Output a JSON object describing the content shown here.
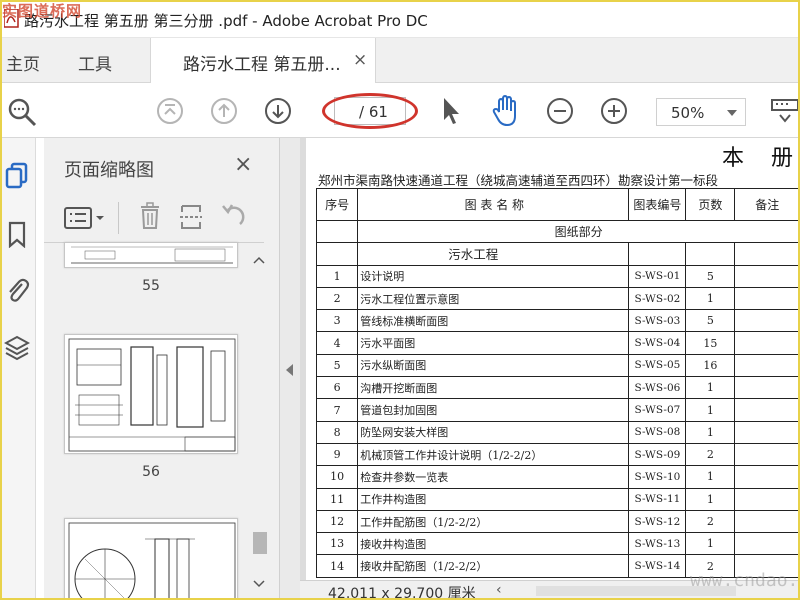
{
  "window": {
    "title": "路污水工程  第五册 第三分册 .pdf - Adobe Acrobat Pro DC",
    "watermark_top": "实图道桥网",
    "watermark_bottom": "www.cndao.com"
  },
  "menu": {
    "home": "主页",
    "tools": "工具",
    "doc_tab_label": "路污水工程 第五册...",
    "doc_tab_close": "×"
  },
  "toolbar": {
    "page_total": "/ 61",
    "zoom": "50%"
  },
  "thumbnails": {
    "title": "页面缩略图",
    "close": "×",
    "pages": [
      {
        "label": "55"
      },
      {
        "label": "56"
      },
      {
        "label": ""
      }
    ]
  },
  "document": {
    "big_title": "本 册 图",
    "subtitle": "郑州市渠南路快速通道工程（绕城高速辅道至西四环）勘察设计第一标段",
    "table": {
      "headers": [
        "序号",
        "图 表 名 称",
        "图表编号",
        "页数",
        "备注"
      ],
      "section": "图纸部分",
      "subsection": "污水工程",
      "rows": [
        {
          "no": "1",
          "name": "设计说明",
          "code": "S-WS-01",
          "pages": "5"
        },
        {
          "no": "2",
          "name": "污水工程位置示意图",
          "code": "S-WS-02",
          "pages": "1"
        },
        {
          "no": "3",
          "name": "管线标准横断面图",
          "code": "S-WS-03",
          "pages": "5"
        },
        {
          "no": "4",
          "name": "污水平面图",
          "code": "S-WS-04",
          "pages": "15"
        },
        {
          "no": "5",
          "name": "污水纵断面图",
          "code": "S-WS-05",
          "pages": "16"
        },
        {
          "no": "6",
          "name": "沟槽开挖断面图",
          "code": "S-WS-06",
          "pages": "1"
        },
        {
          "no": "7",
          "name": "管道包封加固图",
          "code": "S-WS-07",
          "pages": "1"
        },
        {
          "no": "8",
          "name": "防坠网安装大样图",
          "code": "S-WS-08",
          "pages": "1"
        },
        {
          "no": "9",
          "name": "机械顶管工作井设计说明（1/2-2/2）",
          "code": "S-WS-09",
          "pages": "2"
        },
        {
          "no": "10",
          "name": "检查井参数一览表",
          "code": "S-WS-10",
          "pages": "1"
        },
        {
          "no": "11",
          "name": "工作井构造图",
          "code": "S-WS-11",
          "pages": "1"
        },
        {
          "no": "12",
          "name": "工作井配筋图（1/2-2/2）",
          "code": "S-WS-12",
          "pages": "2"
        },
        {
          "no": "13",
          "name": "接收井构造图",
          "code": "S-WS-13",
          "pages": "1"
        },
        {
          "no": "14",
          "name": "接收井配筋图（1/2-2/2）",
          "code": "S-WS-14",
          "pages": "2"
        }
      ]
    }
  },
  "status": {
    "dimensions": "42.011 x 29.700 厘米"
  },
  "colors": {
    "accent_blue": "#2a6bc4",
    "highlight_red": "#d0342c"
  }
}
